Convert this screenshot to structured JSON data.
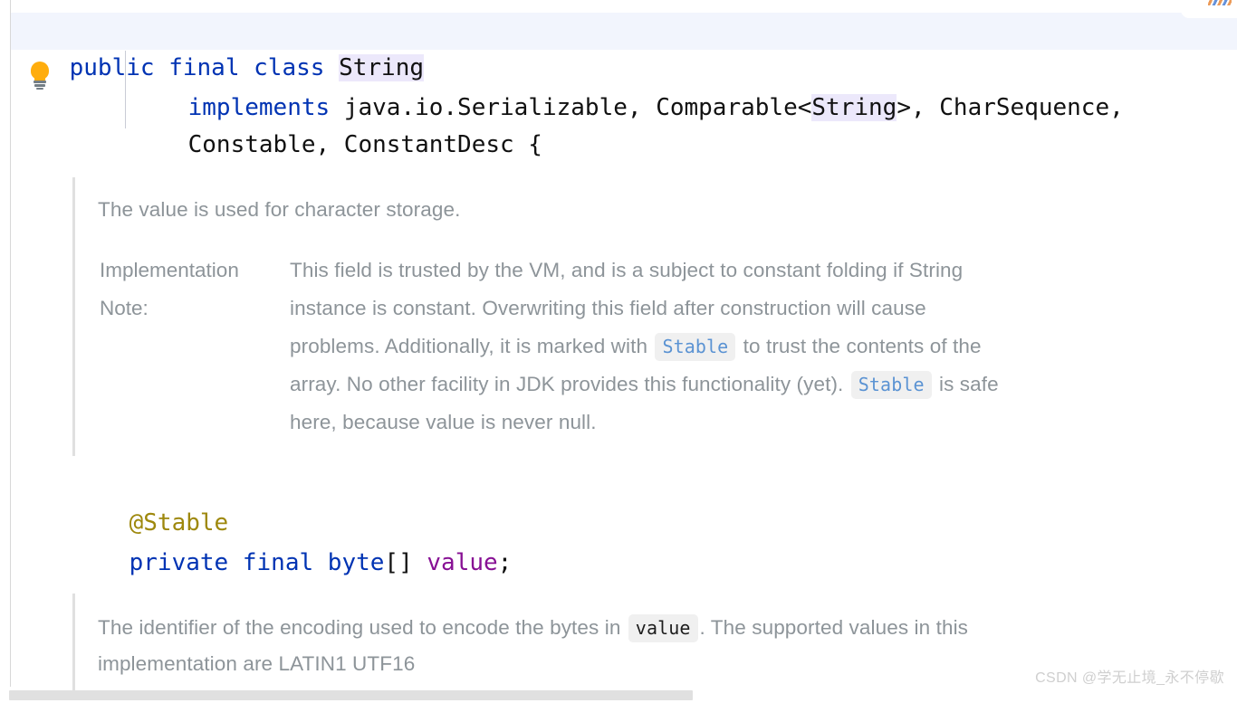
{
  "editor": {
    "language": "java",
    "file_type": "Java source",
    "colors": {
      "keyword": "#0033b3",
      "annotation": "#9e880d",
      "field": "#871094",
      "plain_text": "#111111",
      "doc_text": "#8d9499",
      "inline_code_link": "#5b93d3",
      "inline_code_bg": "#f0f0f0",
      "caret_row_bg": "#f2f5fd",
      "identifier_highlight_bg": "#ece8fb",
      "bulb_icon": "#ffad0d",
      "scrollbar_thumb": "#e0e0e0",
      "doc_left_border": "#e0e0e0"
    },
    "gutter": {
      "intention_icon": "lightbulb-icon"
    },
    "code_lines": [
      {
        "id": "line-class-decl",
        "caret_row": true,
        "tokens": [
          {
            "text": "public",
            "style": "keyword"
          },
          {
            "text": " ",
            "style": "plain"
          },
          {
            "text": "final",
            "style": "keyword"
          },
          {
            "text": " ",
            "style": "plain"
          },
          {
            "text": "class",
            "style": "keyword"
          },
          {
            "text": " ",
            "style": "plain"
          },
          {
            "text": "String",
            "style": "plain",
            "highlight": true
          }
        ]
      },
      {
        "id": "line-implements-1",
        "caret_row": false,
        "tokens": [
          {
            "text": "implements",
            "style": "keyword"
          },
          {
            "text": " java.io.Serializable, Comparable<",
            "style": "plain"
          },
          {
            "text": "String",
            "style": "plain",
            "highlight": true
          },
          {
            "text": ">, CharSequence,",
            "style": "plain"
          }
        ]
      },
      {
        "id": "line-implements-2",
        "caret_row": false,
        "tokens": [
          {
            "text": "Constable, ConstantDesc {",
            "style": "plain"
          }
        ]
      },
      {
        "id": "line-annotation-stable",
        "caret_row": false,
        "tokens": [
          {
            "text": "@Stable",
            "style": "annotation"
          }
        ]
      },
      {
        "id": "line-field-value",
        "caret_row": false,
        "tokens": [
          {
            "text": "private",
            "style": "keyword"
          },
          {
            "text": " ",
            "style": "plain"
          },
          {
            "text": "final",
            "style": "keyword"
          },
          {
            "text": " ",
            "style": "plain"
          },
          {
            "text": "byte",
            "style": "keyword"
          },
          {
            "text": "[] ",
            "style": "plain"
          },
          {
            "text": "value",
            "style": "field"
          },
          {
            "text": ";",
            "style": "plain"
          }
        ]
      }
    ]
  },
  "doc_block_value": {
    "summary": "The value is used for character storage.",
    "impl_note_label_line1": "Implementation",
    "impl_note_label_line2": "Note:",
    "impl_note_lines": [
      "This field is trusted by the VM, and is a subject to constant folding if String",
      "instance is constant. Overwriting this field after construction will cause",
      "problems. Additionally, it is marked with ",
      "array. No other facility in JDK provides this functionality (yet). ",
      "here, because value is never null."
    ],
    "inline_codes": {
      "stable_1": "Stable",
      "stable_2": "Stable"
    },
    "line3_tail": " to trust the contents of the",
    "line4_tail": " is safe"
  },
  "doc_block_coder": {
    "line1_prefix": "The identifier of the encoding used to encode the bytes in ",
    "inline_code_value": "value",
    "line1_suffix": ". The supported values in this",
    "line2": "implementation are LATIN1 UTF16"
  },
  "scrollbar": {
    "orientation": "horizontal",
    "thumb_visible": true
  },
  "watermark": {
    "text": "CSDN @学无止境_永不停歇"
  }
}
